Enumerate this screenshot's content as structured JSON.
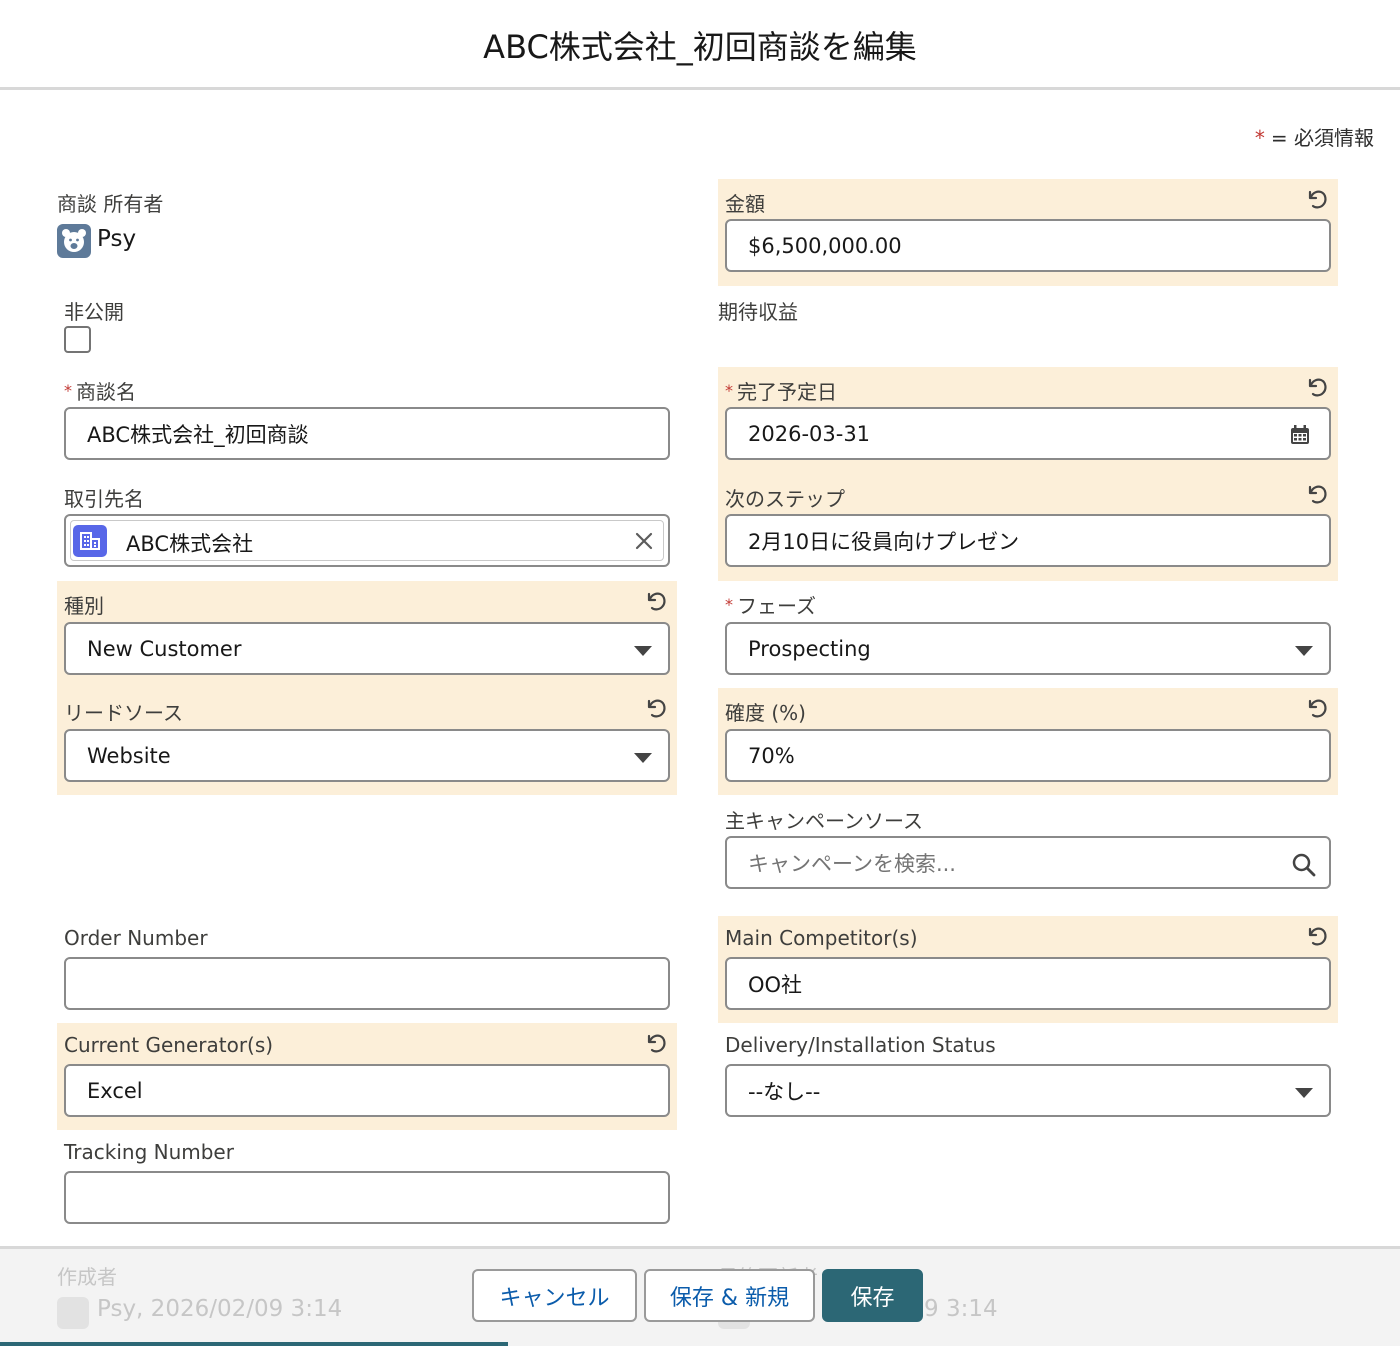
{
  "modal": {
    "title": "ABC株式会社_初回商談を編集"
  },
  "required_legend": {
    "star": "*",
    "text": "= 必須情報"
  },
  "left": {
    "owner": {
      "label": "商談 所有者",
      "name": "Psy",
      "icon": "bear-avatar-icon"
    },
    "private": {
      "label": "非公開",
      "checked": false
    },
    "opportunity_name": {
      "required": "*",
      "label": "商談名",
      "value": "ABC株式会社_初回商談"
    },
    "account_name": {
      "label": "取引先名",
      "value": "ABC株式会社",
      "icon": "account-building-icon"
    },
    "type": {
      "label": "種別",
      "value": "New Customer"
    },
    "lead_source": {
      "label": "リードソース",
      "value": "Website"
    },
    "order_number": {
      "label": "Order Number",
      "value": ""
    },
    "current_generators": {
      "label": "Current Generator(s)",
      "value": "Excel"
    },
    "tracking_number": {
      "label": "Tracking Number",
      "value": ""
    }
  },
  "right": {
    "amount": {
      "label": "金額",
      "value": "$6,500,000.00"
    },
    "expected_revenue": {
      "label": "期待収益",
      "value": ""
    },
    "close_date": {
      "required": "*",
      "label": "完了予定日",
      "value": "2026-03-31"
    },
    "next_step": {
      "label": "次のステップ",
      "value": "2月10日に役員向けプレゼン"
    },
    "stage": {
      "required": "*",
      "label": "フェーズ",
      "value": "Prospecting"
    },
    "probability": {
      "label": "確度 (%)",
      "value": "70%"
    },
    "primary_campaign": {
      "label": "主キャンペーンソース",
      "placeholder": "キャンペーンを検索..."
    },
    "main_competitors": {
      "label": "Main Competitor(s)",
      "value": "OO社"
    },
    "delivery_status": {
      "label": "Delivery/Installation Status",
      "value": "--なし--"
    }
  },
  "footer": {
    "created_by_label": "作成者",
    "created_by_value": "Psy, 2026/02/09 3:14",
    "modified_by_label": "最終更新者",
    "modified_by_value": "9 3:14",
    "cancel_label": "キャンセル",
    "save_new_label": "保存 & 新規",
    "save_label": "保存"
  },
  "colors": {
    "brand": "#2c6775",
    "highlight": "#fcefd9",
    "required": "#c23934",
    "link": "#0b5cab"
  }
}
